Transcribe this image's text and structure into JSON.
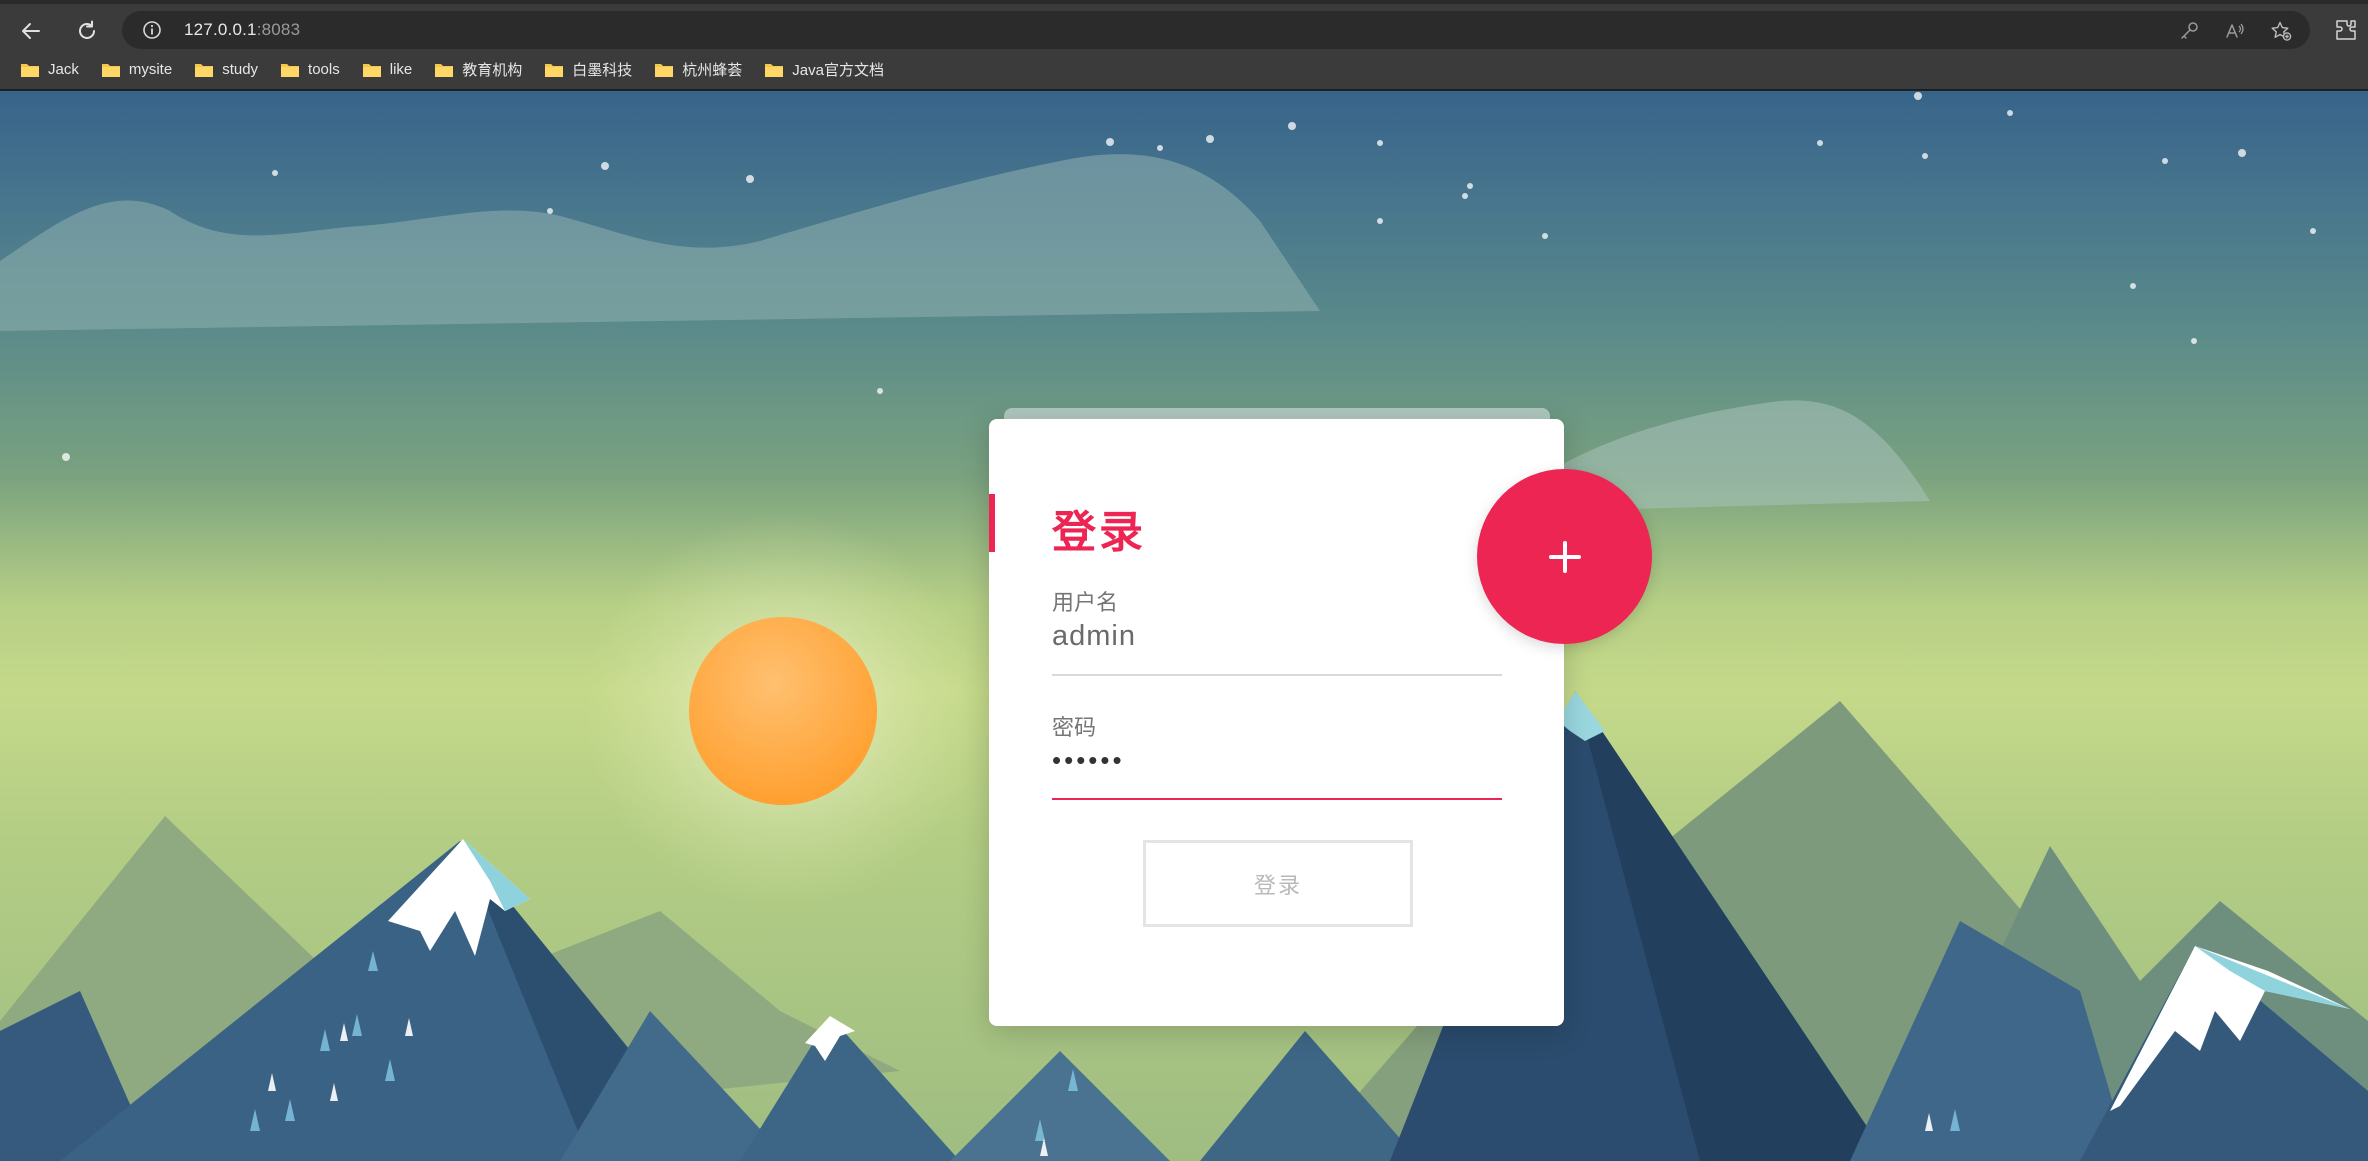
{
  "browser": {
    "url_host": "127.0.0.1",
    "url_port": ":8083",
    "bookmarks": [
      {
        "label": "Jack"
      },
      {
        "label": "mysite"
      },
      {
        "label": "study"
      },
      {
        "label": "tools"
      },
      {
        "label": "like"
      },
      {
        "label": "教育机构"
      },
      {
        "label": "白墨科技"
      },
      {
        "label": "杭州蜂荟"
      },
      {
        "label": "Java官方文档"
      }
    ]
  },
  "login": {
    "title": "登录",
    "username_label": "用户名",
    "username_value": "admin",
    "password_label": "密码",
    "password_masked": "••••••",
    "submit_label": "登录",
    "fab_symbol": "+"
  },
  "colors": {
    "accent": "#ed2553",
    "sun": "#ffab40"
  },
  "icons": [
    "back-icon",
    "reload-icon",
    "info-icon",
    "key-icon",
    "read-aloud-icon",
    "favorite-icon",
    "extensions-icon",
    "folder-icon",
    "plus-icon"
  ]
}
